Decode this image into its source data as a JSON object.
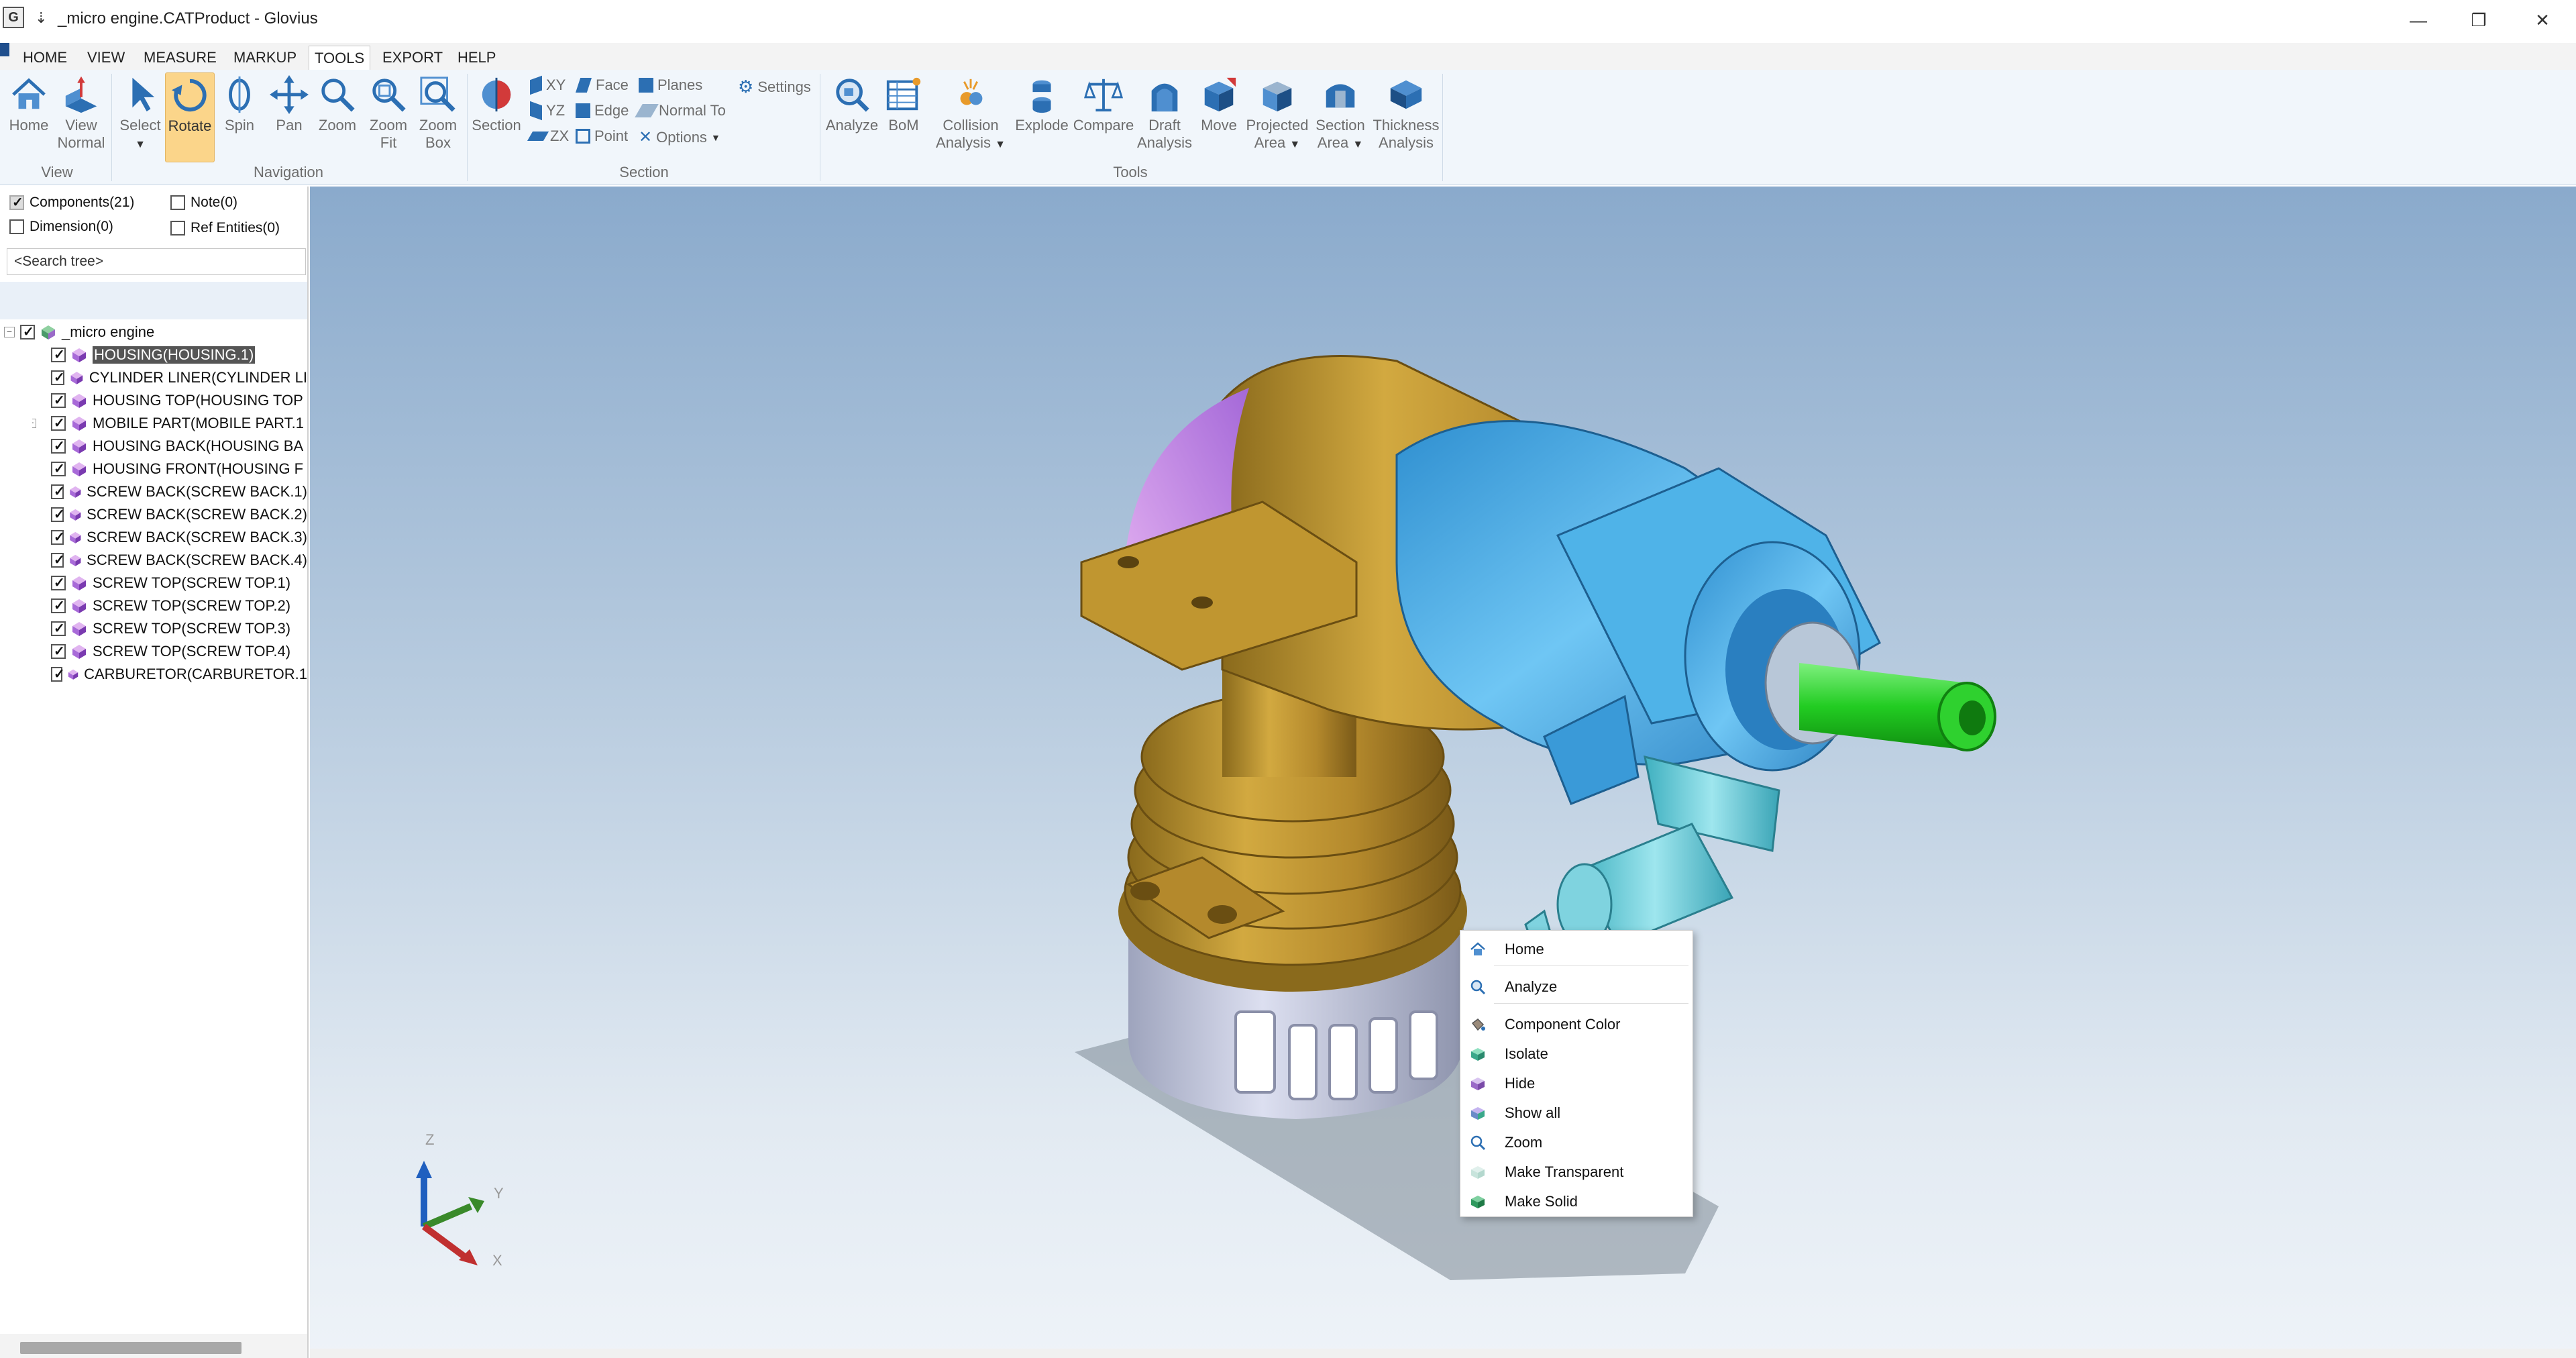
{
  "window": {
    "app_icon": "G",
    "quick_access": "⇣",
    "title": "_micro engine.CATProduct - Glovius",
    "minimize": "—",
    "restore": "❐",
    "close": "✕"
  },
  "menu": {
    "tabs": [
      {
        "label": "HOME"
      },
      {
        "label": "VIEW"
      },
      {
        "label": "MEASURE"
      },
      {
        "label": "MARKUP"
      },
      {
        "label": "TOOLS",
        "active": true
      },
      {
        "label": "EXPORT"
      },
      {
        "label": "HELP"
      }
    ]
  },
  "ribbon": {
    "view_group": {
      "label": "View",
      "home": "Home",
      "view_normal_1": "View",
      "view_normal_2": "Normal"
    },
    "navigation_group": {
      "label": "Navigation",
      "select": "Select",
      "rotate": "Rotate",
      "spin": "Spin",
      "pan": "Pan",
      "zoom": "Zoom",
      "zoom_fit_1": "Zoom",
      "zoom_fit_2": "Fit",
      "zoom_box_1": "Zoom",
      "zoom_box_2": "Box"
    },
    "section_group": {
      "label": "Section",
      "section": "Section",
      "xy": "XY",
      "yz": "YZ",
      "zx": "ZX",
      "face": "Face",
      "edge": "Edge",
      "point": "Point",
      "planes": "Planes",
      "normal_to": "Normal To",
      "options": "Options",
      "settings": "Settings"
    },
    "tools_group": {
      "label": "Tools",
      "analyze": "Analyze",
      "bom": "BoM",
      "collision_1": "Collision",
      "collision_2": "Analysis",
      "explode": "Explode",
      "compare": "Compare",
      "draft_1": "Draft",
      "draft_2": "Analysis",
      "move": "Move",
      "projected_1": "Projected",
      "projected_2": "Area",
      "section_area_1": "Section",
      "section_area_2": "Area",
      "thickness_1": "Thickness",
      "thickness_2": "Analysis"
    }
  },
  "filters": {
    "components": "Components(21)",
    "note": "Note(0)",
    "dimension": "Dimension(0)",
    "ref_entities": "Ref Entities(0)",
    "search_placeholder": "<Search tree>"
  },
  "tree": {
    "root": "_micro engine",
    "items": [
      {
        "label": "HOUSING(HOUSING.1)",
        "selected": true
      },
      {
        "label": "CYLINDER LINER(CYLINDER LI"
      },
      {
        "label": "HOUSING TOP(HOUSING TOP"
      },
      {
        "label": "MOBILE PART(MOBILE PART.1",
        "expandable": true
      },
      {
        "label": "HOUSING BACK(HOUSING BA"
      },
      {
        "label": "HOUSING FRONT(HOUSING F"
      },
      {
        "label": "SCREW BACK(SCREW BACK.1)"
      },
      {
        "label": "SCREW BACK(SCREW BACK.2)"
      },
      {
        "label": "SCREW BACK(SCREW BACK.3)"
      },
      {
        "label": "SCREW BACK(SCREW BACK.4)"
      },
      {
        "label": "SCREW TOP(SCREW TOP.1)"
      },
      {
        "label": "SCREW TOP(SCREW TOP.2)"
      },
      {
        "label": "SCREW TOP(SCREW TOP.3)"
      },
      {
        "label": "SCREW TOP(SCREW TOP.4)"
      },
      {
        "label": "CARBURETOR(CARBURETOR.1"
      }
    ]
  },
  "triad": {
    "z": "Z",
    "y": "Y",
    "x": "X"
  },
  "context_menu": {
    "items": [
      {
        "label": "Home",
        "icon": "home-icon"
      },
      {
        "label": "Analyze",
        "icon": "analyze-icon"
      },
      {
        "label": "Component Color",
        "icon": "paint-bucket-icon"
      },
      {
        "label": "Isolate",
        "icon": "isolate-icon"
      },
      {
        "label": "Hide",
        "icon": "hide-icon"
      },
      {
        "label": "Show all",
        "icon": "show-all-icon"
      },
      {
        "label": "Zoom",
        "icon": "zoom-icon"
      },
      {
        "label": "Make Transparent",
        "icon": "transparent-icon"
      },
      {
        "label": "Make Solid",
        "icon": "solid-icon"
      }
    ]
  },
  "colors": {
    "housing": "#c49a30",
    "front": "#4fb3e8",
    "shaft": "#2fd12f",
    "base": "#c8ccdc",
    "accent_active": "#fbd58a"
  }
}
